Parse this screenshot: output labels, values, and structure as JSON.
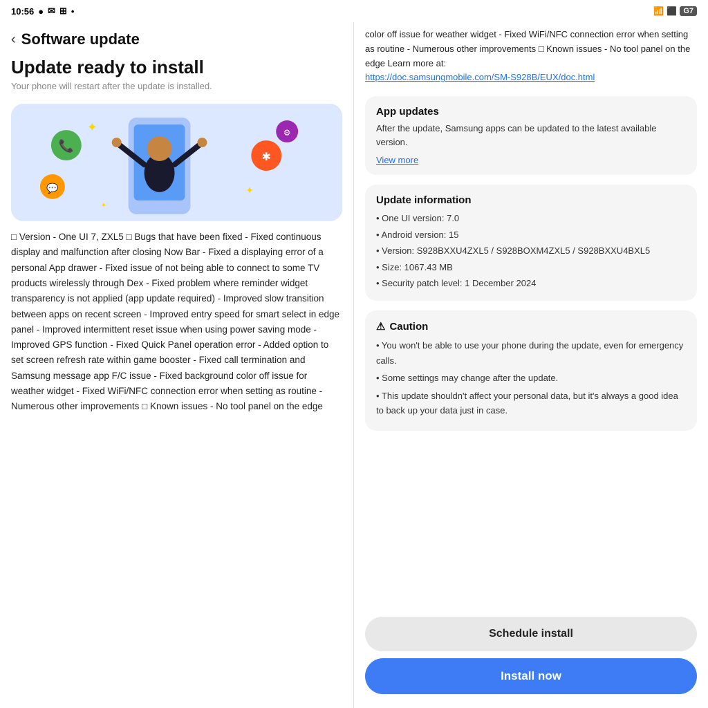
{
  "statusBar": {
    "time": "10:56",
    "batteryLabel": "G7"
  },
  "leftPanel": {
    "navTitle": "Software update",
    "pageTitle": "Update ready to install",
    "pageSubtitle": "Your phone will restart after the update is installed.",
    "description": "□ Version - One UI 7, ZXL5 □ Bugs that have been fixed - Fixed continuous display and malfunction after closing Now Bar - Fixed a displaying error of a personal App drawer - Fixed issue of not being able to connect to some TV products wirelessly through Dex - Fixed problem where reminder widget transparency is not applied (app update required) - Improved slow transition between apps on recent screen - Improved entry speed for smart select in edge panel - Improved intermittent reset issue when using power saving mode - Improved GPS function - Fixed Quick Panel operation error - Added option to set screen refresh rate within game booster - Fixed call termination and Samsung message app F/C issue - Fixed background color off issue for weather widget - Fixed WiFi/NFC connection error when setting as routine - Numerous other improvements □ Known issues - No tool panel on the edge"
  },
  "rightPanel": {
    "topText": "color off issue for weather widget - Fixed WiFi/NFC connection error when setting as routine - Numerous other improvements □ Known issues - No tool panel on the edge Learn more at:",
    "topLink": "https://doc.samsungmobile.com/SM-S928B/EUX/doc.html",
    "appUpdates": {
      "title": "App updates",
      "text": "After the update, Samsung apps can be updated to the latest available version.",
      "viewMore": "View more"
    },
    "updateInfo": {
      "title": "Update information",
      "items": [
        "• One UI version: 7.0",
        "• Android version: 15",
        "• Version: S928BXXU4ZXL5 / S928BOXM4ZXL5 / S928BXXU4BXL5",
        "• Size: 1067.43 MB",
        "• Security patch level: 1 December 2024"
      ]
    },
    "caution": {
      "title": "Caution",
      "items": [
        "• You won't be able to use your phone during the update, even for emergency calls.",
        "• Some settings may change after the update.",
        "• This update shouldn't affect your personal data, but it's always a good idea to back up your data just in case."
      ]
    },
    "scheduleLabel": "Schedule install",
    "installLabel": "Install now"
  }
}
